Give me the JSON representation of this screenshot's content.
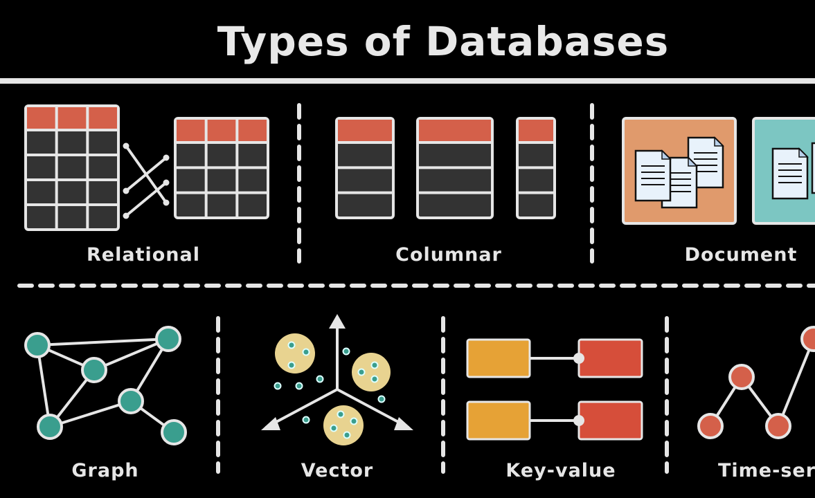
{
  "title": "Types of Databases",
  "categories": {
    "relational": "Relational",
    "columnar": "Columnar",
    "document": "Document",
    "graph": "Graph",
    "vector": "Vector",
    "key_value": "Key-value",
    "time_series": "Time-series"
  },
  "colors": {
    "background": "#000000",
    "foreground": "#e6e6e6",
    "table_header": "#d4604a",
    "table_cell": "#333333",
    "document_orange": "#e09a6c",
    "document_teal": "#7cc6c2",
    "graph_node": "#3a9e8e",
    "vector_cluster": "#e8d390",
    "key": "#e6a236",
    "value": "#d64e3a",
    "time_point": "#d4604a"
  }
}
